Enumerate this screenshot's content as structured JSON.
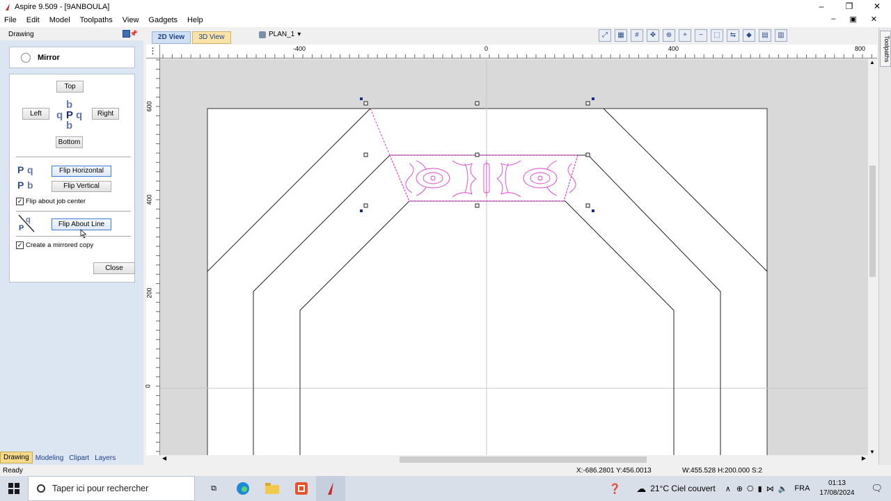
{
  "window": {
    "title": "Aspire 9.509 - [9ANBOULA]",
    "minimize": "–",
    "restore": "❐",
    "close": "✕"
  },
  "menu": [
    "File",
    "Edit",
    "Model",
    "Toolpaths",
    "View",
    "Gadgets",
    "Help"
  ],
  "left_panel": {
    "header": "Drawing",
    "tool_title": "Mirror",
    "buttons": {
      "top": "Top",
      "left": "Left",
      "right": "Right",
      "bottom": "Bottom",
      "flip_horizontal": "Flip Horizontal",
      "flip_vertical": "Flip Vertical",
      "flip_about_line": "Flip About Line",
      "close": "Close"
    },
    "checkboxes": {
      "flip_job_center": {
        "label": "Flip about job center",
        "checked": true
      },
      "mirrored_copy": {
        "label": "Create a mirrored copy",
        "checked": true
      }
    },
    "bottom_tabs": [
      "Drawing",
      "Modeling",
      "Clipart",
      "Layers"
    ]
  },
  "view": {
    "tab_2d": "2D View",
    "tab_3d": "3D View",
    "plan": "PLAN_1",
    "right_tab": "Toolpaths",
    "ruler_h": [
      "-400",
      "0",
      "400",
      "800"
    ],
    "ruler_v": [
      "600",
      "400",
      "200",
      "0"
    ]
  },
  "status": {
    "ready": "Ready",
    "coords": "X:-686.2801 Y:456.0013",
    "dims": "W:455.528   H:200.000  S:2"
  },
  "taskbar": {
    "search_placeholder": "Taper ici pour rechercher",
    "weather": "21°C  Ciel couvert",
    "lang": "FRA",
    "time": "01:13",
    "date": "17/08/2024"
  },
  "colors": {
    "selection": "#e040d8",
    "accent_tab": "#f7d98a"
  }
}
